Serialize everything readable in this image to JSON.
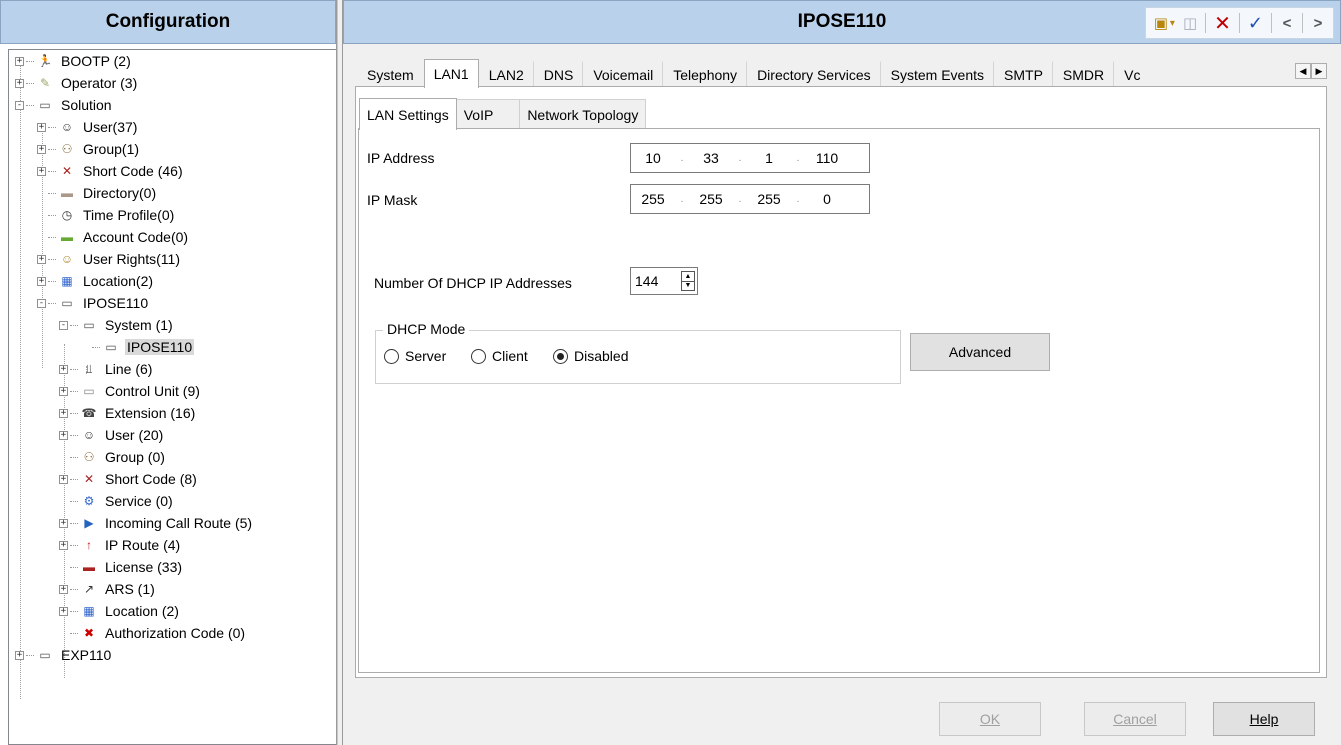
{
  "left": {
    "title": "Configuration",
    "tree": [
      {
        "label": "BOOTP (2)",
        "icon": "bootp-icon"
      },
      {
        "label": "Operator (3)",
        "icon": "operator-icon"
      },
      {
        "label": "Solution",
        "icon": "system-icon"
      },
      {
        "label": "User(37)",
        "icon": "user-icon"
      },
      {
        "label": "Group(1)",
        "icon": "group-icon"
      },
      {
        "label": "Short Code (46)",
        "icon": "short-code-icon"
      },
      {
        "label": "Directory(0)",
        "icon": "directory-icon"
      },
      {
        "label": "Time Profile(0)",
        "icon": "clock-icon"
      },
      {
        "label": "Account Code(0)",
        "icon": "account-code-icon"
      },
      {
        "label": "User Rights(11)",
        "icon": "user-rights-icon"
      },
      {
        "label": "Location(2)",
        "icon": "location-icon"
      },
      {
        "label": "IPOSE110",
        "icon": "system-icon"
      },
      {
        "label": "System (1)",
        "icon": "system-icon"
      },
      {
        "label": "IPOSE110",
        "icon": "system-icon"
      },
      {
        "label": "Line (6)",
        "icon": "line-icon"
      },
      {
        "label": "Control Unit (9)",
        "icon": "control-unit-icon"
      },
      {
        "label": "Extension (16)",
        "icon": "extension-icon"
      },
      {
        "label": "User (20)",
        "icon": "user-icon"
      },
      {
        "label": "Group (0)",
        "icon": "group-icon"
      },
      {
        "label": "Short Code (8)",
        "icon": "short-code-icon"
      },
      {
        "label": "Service (0)",
        "icon": "service-icon"
      },
      {
        "label": "Incoming Call Route (5)",
        "icon": "incoming-call-route-icon"
      },
      {
        "label": "IP Route (4)",
        "icon": "ip-route-icon"
      },
      {
        "label": "License (33)",
        "icon": "license-icon"
      },
      {
        "label": "ARS (1)",
        "icon": "ars-icon"
      },
      {
        "label": "Location (2)",
        "icon": "location-icon"
      },
      {
        "label": "Authorization Code (0)",
        "icon": "authorization-code-icon"
      },
      {
        "label": "EXP110",
        "icon": "system-icon"
      }
    ]
  },
  "right": {
    "title": "IPOSE110",
    "toolbar": {
      "new": "new-icon",
      "save": "save-icon",
      "delete": "delete-icon",
      "ok": "checkmark-icon",
      "prev": "<",
      "next": ">"
    },
    "tabs": [
      "System",
      "LAN1",
      "LAN2",
      "DNS",
      "Voicemail",
      "Telephony",
      "Directory Services",
      "System Events",
      "SMTP",
      "SMDR",
      "Vc"
    ],
    "subtabs": [
      "LAN Settings",
      "VoIP",
      "Network Topology"
    ],
    "form": {
      "ip_address_label": "IP Address",
      "ip_address": [
        "10",
        "33",
        "1",
        "110"
      ],
      "ip_mask_label": "IP Mask",
      "ip_mask": [
        "255",
        "255",
        "255",
        "0"
      ],
      "dhcp_count_label": "Number Of DHCP IP Addresses",
      "dhcp_count": "144",
      "dhcp_mode_label": "DHCP Mode",
      "dhcp_modes": [
        "Server",
        "Client",
        "Disabled"
      ],
      "dhcp_mode_selected": "Disabled",
      "advanced_label": "Advanced"
    },
    "buttons": {
      "ok": "OK",
      "cancel": "Cancel",
      "help": "Help"
    }
  }
}
